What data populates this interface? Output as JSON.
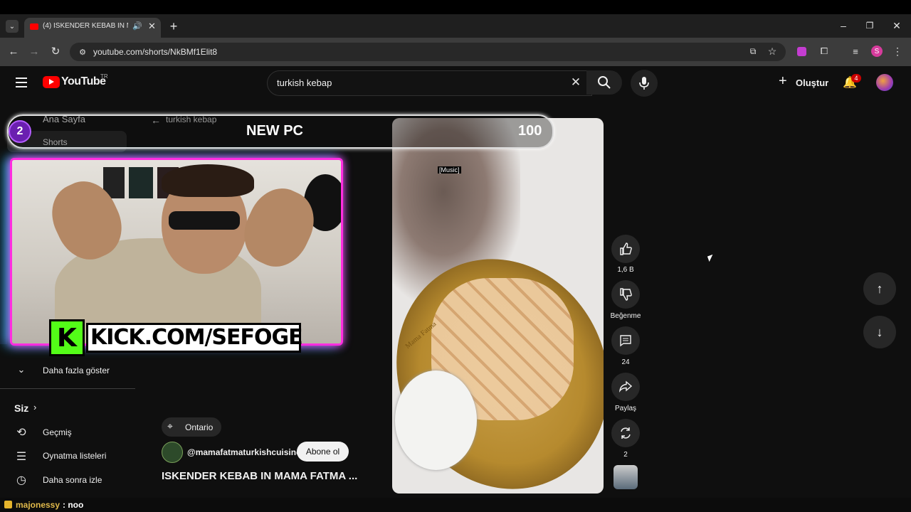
{
  "browser": {
    "tab_title": "(4) ISKENDER KEBAB IN MA",
    "url": "youtube.com/shorts/NkBMf1Elit8",
    "profile_initial": "S"
  },
  "header": {
    "logo_text": "YouTube",
    "region": "TR",
    "search_value": "turkish kebap",
    "create_label": "Oluştur",
    "notif_count": "4"
  },
  "sidebar": {
    "home": "Ana Sayfa",
    "shorts": "Shorts",
    "show_more": "Daha fazla göster",
    "you_section": "Siz",
    "history": "Geçmiş",
    "playlists": "Oynatma listeleri",
    "watch_later": "Daha sonra izle"
  },
  "back_search": "turkish kebap",
  "overlay": {
    "badge_num": "2",
    "banner_title": "NEW PC",
    "banner_value": "100",
    "kick_text": "KICK.COM/SEFOGE",
    "kick_logo": "K"
  },
  "video": {
    "caption": "[Music]",
    "location": "Ontario",
    "channel": "@mamafatmaturkishcuisine",
    "subscribe": "Abone ol",
    "title": "ISKENDER KEBAB IN MAMA FATMA ...",
    "plate_text": "Mama Fatma"
  },
  "actions": {
    "likes": "1,6 B",
    "dislike_label": "Beğenme",
    "comments": "24",
    "share_label": "Paylaş",
    "remix": "2"
  },
  "chat": {
    "user": "majonessy",
    "message": ": noo"
  }
}
